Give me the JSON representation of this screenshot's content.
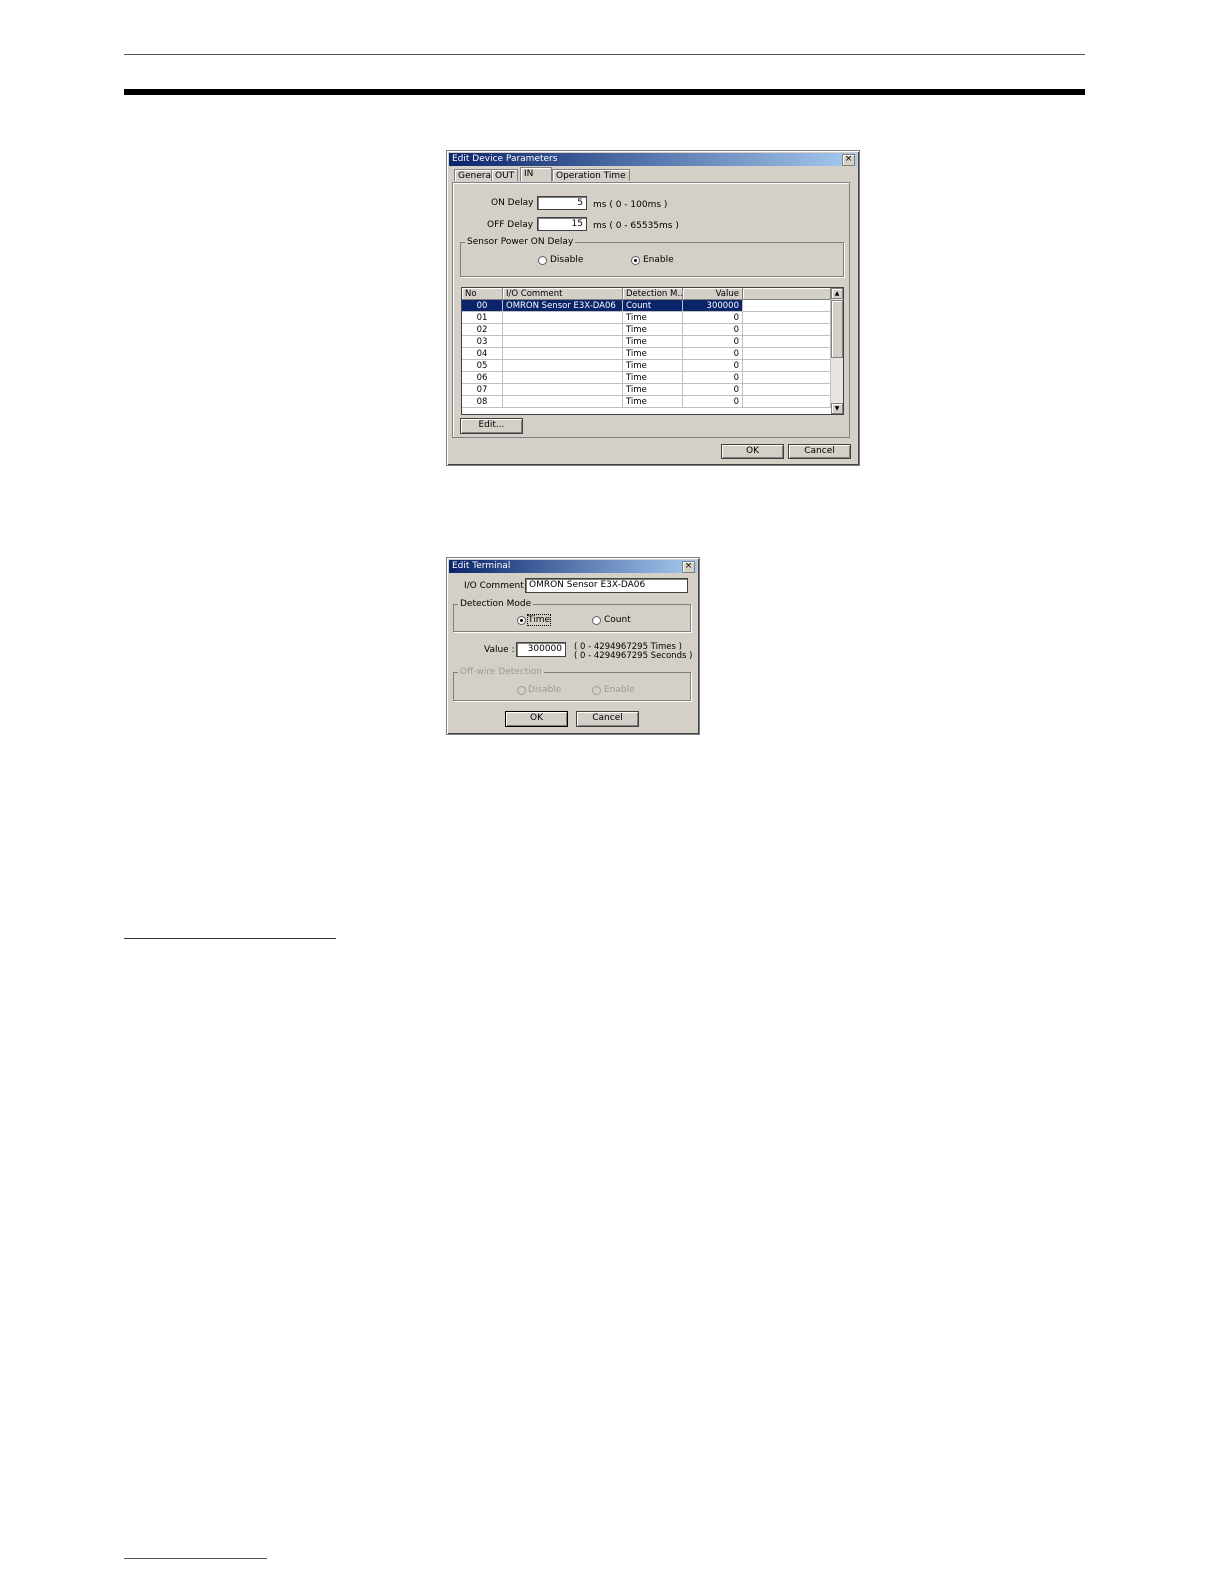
{
  "dialog1": {
    "title": "Edit Device Parameters",
    "close": "×",
    "tabs": [
      "General",
      "OUT",
      "IN",
      "Operation Time"
    ],
    "on_delay_label": "ON Delay :",
    "on_delay_value": "5",
    "on_delay_range": "ms ( 0 - 100ms )",
    "off_delay_label": "OFF Delay :",
    "off_delay_value": "15",
    "off_delay_range": "ms ( 0 - 65535ms )",
    "sensor_group": "Sensor Power ON Delay",
    "disable_label": "Disable",
    "enable_label": "Enable",
    "sensor_selected": "enable",
    "columns": [
      "No",
      "I/O Comment",
      "Detection M..",
      "Value"
    ],
    "rows": [
      {
        "no": "00",
        "comment": "OMRON Sensor E3X-DA06",
        "mode": "Count",
        "value": "300000",
        "selected": true
      },
      {
        "no": "01",
        "comment": "",
        "mode": "Time",
        "value": "0"
      },
      {
        "no": "02",
        "comment": "",
        "mode": "Time",
        "value": "0"
      },
      {
        "no": "03",
        "comment": "",
        "mode": "Time",
        "value": "0"
      },
      {
        "no": "04",
        "comment": "",
        "mode": "Time",
        "value": "0"
      },
      {
        "no": "05",
        "comment": "",
        "mode": "Time",
        "value": "0"
      },
      {
        "no": "06",
        "comment": "",
        "mode": "Time",
        "value": "0"
      },
      {
        "no": "07",
        "comment": "",
        "mode": "Time",
        "value": "0"
      },
      {
        "no": "08",
        "comment": "",
        "mode": "Time",
        "value": "0"
      }
    ],
    "scroll_up": "▲",
    "scroll_down": "▼",
    "edit_button": "Edit...",
    "ok_button": "OK",
    "cancel_button": "Cancel"
  },
  "dialog2": {
    "title": "Edit Terminal",
    "close": "×",
    "io_comment_label": "I/O Comment :",
    "io_comment_value": "OMRON Sensor E3X-DA06",
    "detection_group": "Detection Mode",
    "time_label": "Time",
    "count_label": "Count",
    "detection_selected": "time",
    "value_label": "Value :",
    "value_value": "300000",
    "range_times": "( 0 - 4294967295 Times )",
    "range_seconds": "( 0 - 4294967295 Seconds )",
    "offwire_group": "Off-wire Detection",
    "offwire_disable": "Disable",
    "offwire_enable": "Enable",
    "ok_button": "OK",
    "cancel_button": "Cancel"
  }
}
